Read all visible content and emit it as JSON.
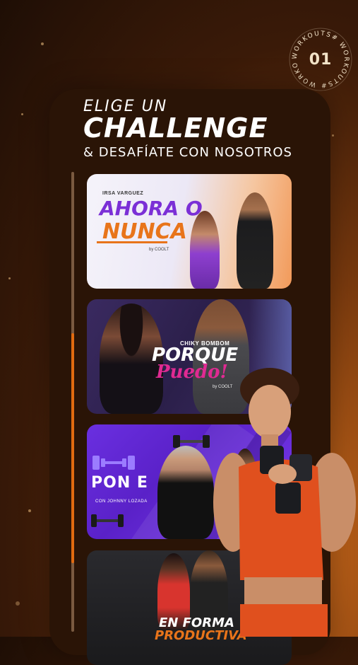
{
  "badge": {
    "ring_text": "WORKOUTS# WORKOUTS# WORKOUTS#",
    "number": "01"
  },
  "heading": {
    "line1": "ELIGE UN",
    "line2": "CHALLENGE",
    "line3": "& DESAFÍATE CON NOSOTROS"
  },
  "progress": {
    "fraction": 0.5
  },
  "cards": [
    {
      "tag": "IRSA VARGUEZ",
      "title_line1": "AHORA O",
      "title_line2": "NUNCA",
      "brand": "by COOLT"
    },
    {
      "subtitle": "CHIKY BOMBOM",
      "title_line1": "PORQUE",
      "title_line2": "Puedo!",
      "brand": "by COOLT"
    },
    {
      "title": "PON E",
      "subtitle": "CON JOHNNY LOZADA"
    },
    {
      "title_line1": "EN FORMA",
      "title_line2": "PRODUCTIVA"
    }
  ],
  "colors": {
    "accent": "#e06a10",
    "purple": "#7b2fd6",
    "pink": "#e02a92"
  }
}
